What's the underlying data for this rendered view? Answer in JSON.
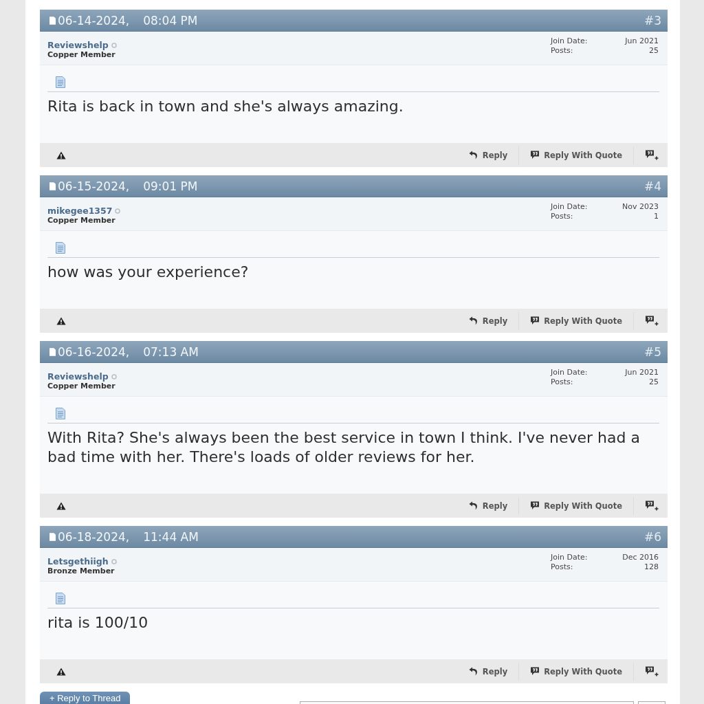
{
  "posts": [
    {
      "date": "06-14-2024,",
      "time": "08:04 PM",
      "number": "#3",
      "username": "Reviewshelp",
      "online": false,
      "rank": "Copper Member",
      "join_label": "Join Date:",
      "join_date": "Jun 2021",
      "posts_label": "Posts:",
      "post_count": "25",
      "message": "Rita is back in town and she's always amazing.",
      "reply": "Reply",
      "reply_quote": "Reply With Quote"
    },
    {
      "date": "06-15-2024,",
      "time": "09:01 PM",
      "number": "#4",
      "username": "mikegee1357",
      "online": false,
      "rank": "Copper Member",
      "join_label": "Join Date:",
      "join_date": "Nov 2023",
      "posts_label": "Posts:",
      "post_count": "1",
      "message": "how was your experience?",
      "reply": "Reply",
      "reply_quote": "Reply With Quote"
    },
    {
      "date": "06-16-2024,",
      "time": "07:13 AM",
      "number": "#5",
      "username": "Reviewshelp",
      "online": false,
      "rank": "Copper Member",
      "join_label": "Join Date:",
      "join_date": "Jun 2021",
      "posts_label": "Posts:",
      "post_count": "25",
      "message": "With Rita? She's always been the best service in town I think. I've never had a bad time with her. There's loads of older reviews for her.",
      "reply": "Reply",
      "reply_quote": "Reply With Quote"
    },
    {
      "date": "06-18-2024,",
      "time": "11:44 AM",
      "number": "#6",
      "username": "Letsgethiigh",
      "online": false,
      "rank": "Bronze Member",
      "join_label": "Join Date:",
      "join_date": "Dec 2016",
      "posts_label": "Posts:",
      "post_count": "128",
      "message": "rita is 100/10",
      "reply": "Reply",
      "reply_quote": "Reply With Quote"
    }
  ],
  "reply_to_thread": "+ Reply to Thread"
}
